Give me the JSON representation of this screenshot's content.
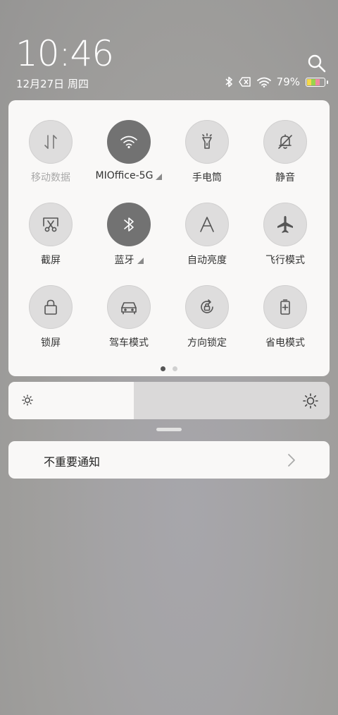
{
  "status_bar": {
    "time": "10:46",
    "date": "12月27日 周四",
    "battery_percent": "79%",
    "battery_level": 0.79
  },
  "quick_settings": {
    "tiles": [
      {
        "id": "mobile-data",
        "label": "移动数据",
        "icon": "data-arrows-icon",
        "active": false,
        "dim": true,
        "has_menu": false
      },
      {
        "id": "wifi",
        "label": "MIOffice-5G",
        "icon": "wifi-icon",
        "active": true,
        "dim": false,
        "has_menu": true
      },
      {
        "id": "flashlight",
        "label": "手电筒",
        "icon": "flashlight-icon",
        "active": false,
        "dim": false,
        "has_menu": false
      },
      {
        "id": "mute",
        "label": "静音",
        "icon": "bell-off-icon",
        "active": false,
        "dim": false,
        "has_menu": false
      },
      {
        "id": "screenshot",
        "label": "截屏",
        "icon": "scissors-icon",
        "active": false,
        "dim": false,
        "has_menu": false
      },
      {
        "id": "bluetooth",
        "label": "蓝牙",
        "icon": "bluetooth-icon",
        "active": true,
        "dim": false,
        "has_menu": true
      },
      {
        "id": "auto-brightness",
        "label": "自动亮度",
        "icon": "letter-a-icon",
        "active": false,
        "dim": false,
        "has_menu": false
      },
      {
        "id": "airplane",
        "label": "飞行模式",
        "icon": "airplane-icon",
        "active": false,
        "dim": false,
        "has_menu": false
      },
      {
        "id": "lock-screen",
        "label": "锁屏",
        "icon": "lock-icon",
        "active": false,
        "dim": false,
        "has_menu": false
      },
      {
        "id": "driving-mode",
        "label": "驾车模式",
        "icon": "car-icon",
        "active": false,
        "dim": false,
        "has_menu": false
      },
      {
        "id": "rotation-lock",
        "label": "方向锁定",
        "icon": "rotation-lock-icon",
        "active": false,
        "dim": false,
        "has_menu": false
      },
      {
        "id": "battery-saver",
        "label": "省电模式",
        "icon": "battery-plus-icon",
        "active": false,
        "dim": false,
        "has_menu": false
      }
    ],
    "page_count": 2,
    "current_page": 0
  },
  "brightness": {
    "level": 0.39
  },
  "notifications": {
    "unimportant_label": "不重要通知"
  },
  "colors": {
    "active_tile": "#727272",
    "inactive_tile": "#dedddd",
    "panel": "#f9f8f7"
  }
}
